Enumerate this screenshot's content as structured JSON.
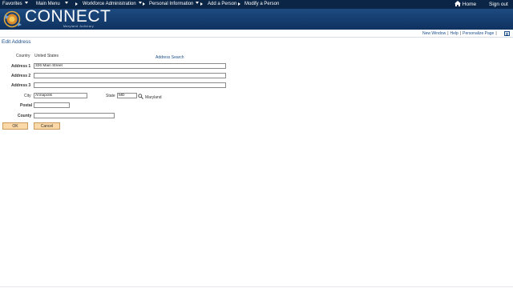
{
  "nav": {
    "items": [
      {
        "label": "Favorites",
        "dropdown": true
      },
      {
        "label": "Main Menu",
        "dropdown": true
      },
      {
        "label": "Workforce Administration",
        "dropdown": true
      },
      {
        "label": "Personal Information",
        "dropdown": true
      },
      {
        "label": "Add a Person",
        "dropdown": false
      },
      {
        "label": "Modify a Person",
        "dropdown": false
      }
    ],
    "home_label": "Home",
    "signout_label": "Sign out"
  },
  "brand": {
    "name": "CONNECT",
    "subtitle": "Maryland Judiciary"
  },
  "utility_links": {
    "new_window": "New Window",
    "help": "Help",
    "personalize": "Personalize Page"
  },
  "page": {
    "title": "Edit Address"
  },
  "form": {
    "country_label": "Country",
    "country_value": "United States",
    "address_search": "Address Search",
    "address1_label": "Address 1",
    "address1_value": "326 Main Street",
    "address2_label": "Address 2",
    "address2_value": "",
    "address3_label": "Address 3",
    "address3_value": "",
    "city_label": "City",
    "city_value": "Annapolis",
    "state_label": "State",
    "state_value": "MD",
    "state_description": "Maryland",
    "postal_label": "Postal",
    "postal_value": "",
    "county_label": "County",
    "county_value": ""
  },
  "buttons": {
    "ok": "OK",
    "cancel": "Cancel"
  },
  "colors": {
    "nav_bg": "#0b2546",
    "banner_bg": "#1d4a80",
    "link": "#1c4f8b",
    "button_bg": "#fbd8a8"
  }
}
